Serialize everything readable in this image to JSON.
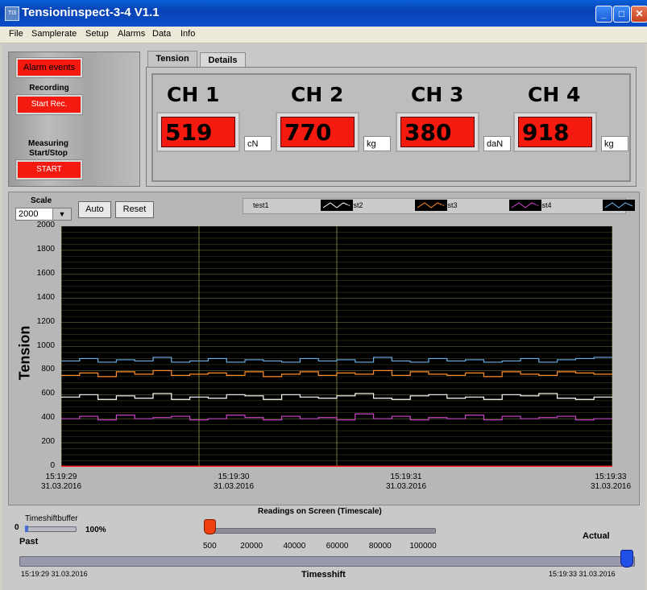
{
  "window": {
    "title": "Tensioninspect-3-4  V1.1",
    "icon_text": "TI3",
    "minimize": "_",
    "maximize": "□",
    "close": "✕"
  },
  "menu": [
    "File",
    "Samplerate",
    "Setup",
    "Alarms",
    "Data",
    "Info"
  ],
  "left": {
    "alarm_label": "Alarm events",
    "recording_label": "Recording",
    "start_rec_label": "Start Rec.",
    "measuring_label": "Measuring Start/Stop",
    "start_label": "START"
  },
  "tabs": [
    "Tension",
    "Details"
  ],
  "channels": [
    {
      "name": "CH 1",
      "value": "519",
      "unit": "cN"
    },
    {
      "name": "CH 2",
      "value": "770",
      "unit": "kg"
    },
    {
      "name": "CH 3",
      "value": "380",
      "unit": "daN"
    },
    {
      "name": "CH 4",
      "value": "918",
      "unit": "kg"
    }
  ],
  "graph": {
    "scale_label": "Scale",
    "scale_value": "2000",
    "auto_label": "Auto",
    "reset_label": "Reset"
  },
  "colors": {
    "accent_red": "#f41a0f",
    "plot_bg": "#000000",
    "grid": "#c8c864"
  },
  "chart_data": {
    "type": "line",
    "ylabel": "Tension",
    "ylim": [
      0,
      2000
    ],
    "yticks": [
      "0",
      "200",
      "400",
      "600",
      "800",
      "1000",
      "1200",
      "1400",
      "1600",
      "1800",
      "2000"
    ],
    "xticks": [
      {
        "time": "15:19:29",
        "date": "31.03.2016"
      },
      {
        "time": "15:19:30",
        "date": "31.03.2016"
      },
      {
        "time": "15:19:31",
        "date": "31.03.2016"
      },
      {
        "time": "15:19:33",
        "date": "31.03.2016"
      }
    ],
    "series": [
      {
        "name": "test1",
        "color": "#ffffff",
        "values": [
          580,
          600,
          560,
          590,
          570,
          610,
          560,
          580,
          570,
          600,
          590,
          560,
          600,
          580,
          570,
          590,
          610,
          570,
          560,
          590,
          600,
          570,
          580,
          560,
          600,
          590,
          610,
          570,
          560,
          580
        ]
      },
      {
        "name": "test2",
        "color": "#ff8c2a",
        "values": [
          760,
          780,
          750,
          790,
          770,
          800,
          760,
          770,
          780,
          760,
          790,
          750,
          770,
          790,
          760,
          780,
          770,
          800,
          760,
          790,
          770,
          760,
          780,
          750,
          790,
          770,
          760,
          790,
          780,
          770
        ]
      },
      {
        "name": "test3",
        "color": "#cc44cc",
        "values": [
          400,
          420,
          390,
          430,
          400,
          410,
          420,
          390,
          400,
          430,
          410,
          390,
          420,
          400,
          410,
          390,
          440,
          400,
          420,
          390,
          410,
          400,
          430,
          390,
          420,
          400,
          410,
          420,
          390,
          400
        ]
      },
      {
        "name": "test4",
        "color": "#6ab0e8",
        "values": [
          880,
          900,
          870,
          890,
          880,
          910,
          870,
          880,
          900,
          870,
          890,
          880,
          870,
          900,
          880,
          890,
          870,
          910,
          880,
          870,
          900,
          880,
          890,
          870,
          880,
          900,
          870,
          890,
          900,
          910
        ]
      },
      {
        "name": "",
        "color": "#ff2020",
        "values": [
          0,
          0,
          0,
          0,
          0,
          0,
          0,
          0,
          0,
          0,
          0,
          0,
          0,
          0,
          0,
          0,
          0,
          0,
          0,
          0,
          0,
          0,
          0,
          0,
          0,
          0,
          0,
          0,
          0,
          0
        ]
      }
    ]
  },
  "bottom": {
    "timeshiftbuffer_label": "Timeshiftbuffer",
    "buffer_min": "0",
    "buffer_max": "100%",
    "past_label": "Past",
    "readings_label": "Readings on Screen (Timescale)",
    "readings_ticks": [
      "500",
      "20000",
      "40000",
      "60000",
      "80000",
      "100000"
    ],
    "readings_value": 500,
    "actual_label": "Actual",
    "timeshift_label": "Timesshift",
    "time_start": "15:19:29 31.03.2016",
    "time_end": "15:19:33 31.03.2016"
  }
}
